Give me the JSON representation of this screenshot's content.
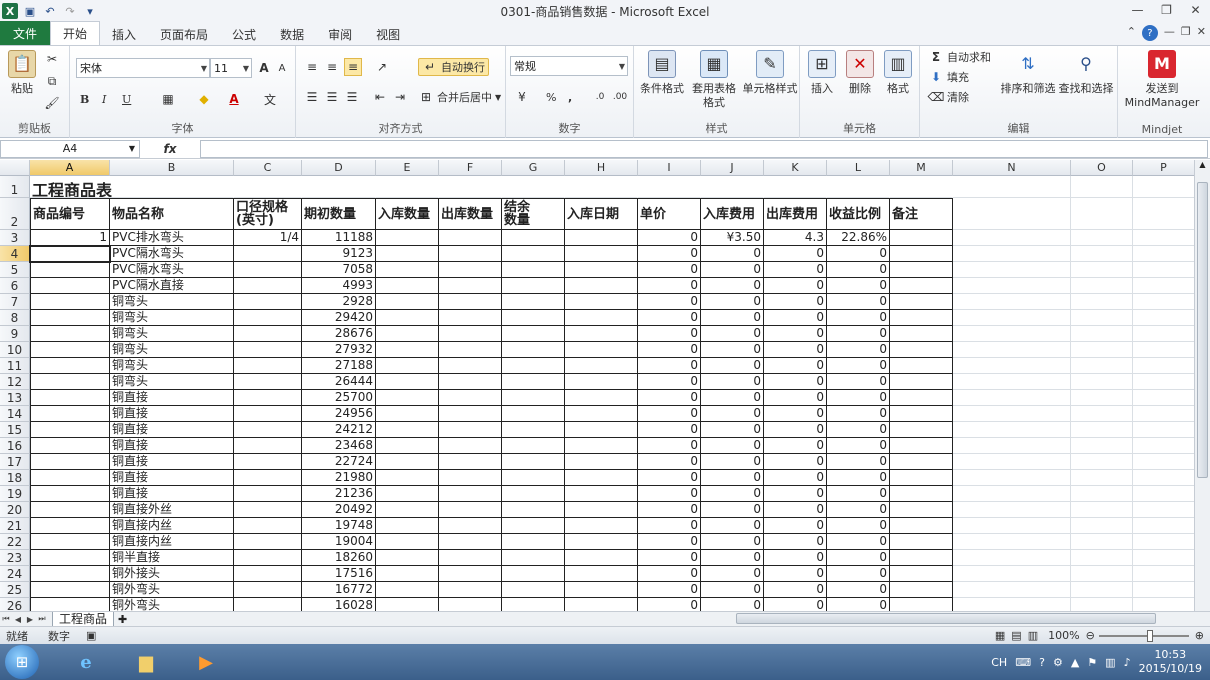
{
  "window": {
    "title": "0301-商品销售数据 - Microsoft Excel"
  },
  "ribbon_tabs": [
    "文件",
    "开始",
    "插入",
    "页面布局",
    "公式",
    "数据",
    "审阅",
    "视图"
  ],
  "ribbon": {
    "clipboard": {
      "label": "剪贴板",
      "paste": "粘贴"
    },
    "font": {
      "label": "字体",
      "name": "宋体",
      "size": "11",
      "bold": "B",
      "italic": "I",
      "underline": "U"
    },
    "alignment": {
      "label": "对齐方式",
      "wrap": "自动换行",
      "merge": "合并后居中"
    },
    "number": {
      "label": "数字",
      "format": "常规",
      "percent": "%",
      "comma": ","
    },
    "styles": {
      "label": "样式",
      "conditional": "条件格式",
      "table": "套用表格格式",
      "cell": "单元格样式"
    },
    "cells": {
      "label": "单元格",
      "insert": "插入",
      "delete": "删除",
      "format": "格式"
    },
    "editing": {
      "label": "编辑",
      "autosum": "自动求和",
      "fill": "填充",
      "clear": "清除",
      "sort": "排序和筛选",
      "find": "查找和选择"
    },
    "mindjet": {
      "label": "Mindjet",
      "send": "发送到 MindManager"
    }
  },
  "formula_bar": {
    "name_box": "A4",
    "fx": "fx",
    "content": ""
  },
  "columns": [
    "A",
    "B",
    "C",
    "D",
    "E",
    "F",
    "G",
    "H",
    "I",
    "J",
    "K",
    "L",
    "M",
    "N",
    "O",
    "P"
  ],
  "sheet": {
    "title": "工程商品表",
    "headers": [
      "商品编号",
      "物品名称",
      "口径规格\n(英寸)",
      "期初数量",
      "入库数量",
      "出库数量",
      "结余\n数量",
      "入库日期",
      "单价",
      "入库费用",
      "出库费用",
      "收益比例",
      "备注"
    ],
    "rows": [
      {
        "id": "1",
        "name": "PVC排水弯头",
        "spec": "1/4",
        "qty": "11188",
        "price": "0",
        "in_fee": "¥3.50",
        "out_fee": "4.3",
        "ratio": "22.86%"
      },
      {
        "id": "",
        "name": "PVC隔水弯头",
        "spec": "",
        "qty": "9123",
        "price": "0",
        "in_fee": "0",
        "out_fee": "0",
        "ratio": "0"
      },
      {
        "id": "",
        "name": "PVC隔水弯头",
        "spec": "",
        "qty": "7058",
        "price": "0",
        "in_fee": "0",
        "out_fee": "0",
        "ratio": "0"
      },
      {
        "id": "",
        "name": "PVC隔水直接",
        "spec": "",
        "qty": "4993",
        "price": "0",
        "in_fee": "0",
        "out_fee": "0",
        "ratio": "0"
      },
      {
        "id": "",
        "name": "铜弯头",
        "spec": "",
        "qty": "2928",
        "price": "0",
        "in_fee": "0",
        "out_fee": "0",
        "ratio": "0"
      },
      {
        "id": "",
        "name": "铜弯头",
        "spec": "",
        "qty": "29420",
        "price": "0",
        "in_fee": "0",
        "out_fee": "0",
        "ratio": "0"
      },
      {
        "id": "",
        "name": "铜弯头",
        "spec": "",
        "qty": "28676",
        "price": "0",
        "in_fee": "0",
        "out_fee": "0",
        "ratio": "0"
      },
      {
        "id": "",
        "name": "铜弯头",
        "spec": "",
        "qty": "27932",
        "price": "0",
        "in_fee": "0",
        "out_fee": "0",
        "ratio": "0"
      },
      {
        "id": "",
        "name": "铜弯头",
        "spec": "",
        "qty": "27188",
        "price": "0",
        "in_fee": "0",
        "out_fee": "0",
        "ratio": "0"
      },
      {
        "id": "",
        "name": "铜弯头",
        "spec": "",
        "qty": "26444",
        "price": "0",
        "in_fee": "0",
        "out_fee": "0",
        "ratio": "0"
      },
      {
        "id": "",
        "name": "铜直接",
        "spec": "",
        "qty": "25700",
        "price": "0",
        "in_fee": "0",
        "out_fee": "0",
        "ratio": "0"
      },
      {
        "id": "",
        "name": "铜直接",
        "spec": "",
        "qty": "24956",
        "price": "0",
        "in_fee": "0",
        "out_fee": "0",
        "ratio": "0"
      },
      {
        "id": "",
        "name": "铜直接",
        "spec": "",
        "qty": "24212",
        "price": "0",
        "in_fee": "0",
        "out_fee": "0",
        "ratio": "0"
      },
      {
        "id": "",
        "name": "铜直接",
        "spec": "",
        "qty": "23468",
        "price": "0",
        "in_fee": "0",
        "out_fee": "0",
        "ratio": "0"
      },
      {
        "id": "",
        "name": "铜直接",
        "spec": "",
        "qty": "22724",
        "price": "0",
        "in_fee": "0",
        "out_fee": "0",
        "ratio": "0"
      },
      {
        "id": "",
        "name": "铜直接",
        "spec": "",
        "qty": "21980",
        "price": "0",
        "in_fee": "0",
        "out_fee": "0",
        "ratio": "0"
      },
      {
        "id": "",
        "name": "铜直接",
        "spec": "",
        "qty": "21236",
        "price": "0",
        "in_fee": "0",
        "out_fee": "0",
        "ratio": "0"
      },
      {
        "id": "",
        "name": "铜直接外丝",
        "spec": "",
        "qty": "20492",
        "price": "0",
        "in_fee": "0",
        "out_fee": "0",
        "ratio": "0"
      },
      {
        "id": "",
        "name": "铜直接内丝",
        "spec": "",
        "qty": "19748",
        "price": "0",
        "in_fee": "0",
        "out_fee": "0",
        "ratio": "0"
      },
      {
        "id": "",
        "name": "铜直接内丝",
        "spec": "",
        "qty": "19004",
        "price": "0",
        "in_fee": "0",
        "out_fee": "0",
        "ratio": "0"
      },
      {
        "id": "",
        "name": "铜半直接",
        "spec": "",
        "qty": "18260",
        "price": "0",
        "in_fee": "0",
        "out_fee": "0",
        "ratio": "0"
      },
      {
        "id": "",
        "name": "铜外接头",
        "spec": "",
        "qty": "17516",
        "price": "0",
        "in_fee": "0",
        "out_fee": "0",
        "ratio": "0"
      },
      {
        "id": "",
        "name": "铜外弯头",
        "spec": "",
        "qty": "16772",
        "price": "0",
        "in_fee": "0",
        "out_fee": "0",
        "ratio": "0"
      },
      {
        "id": "",
        "name": "铜外弯头",
        "spec": "",
        "qty": "16028",
        "price": "0",
        "in_fee": "0",
        "out_fee": "0",
        "ratio": "0"
      }
    ]
  },
  "sheet_tabs": [
    "工程商品"
  ],
  "status": {
    "ready": "就绪",
    "mode": "数字",
    "zoom": "100%"
  },
  "taskbar": {
    "lang": "CH",
    "time": "10:53",
    "date": "2015/10/19"
  }
}
